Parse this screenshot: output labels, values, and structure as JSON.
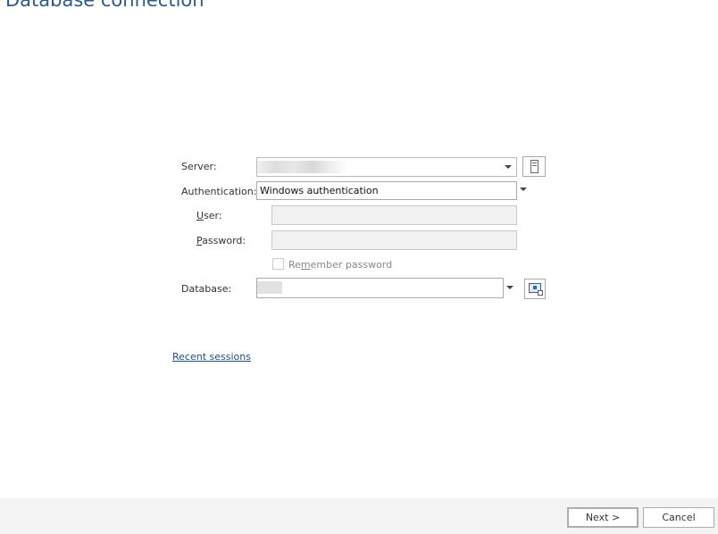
{
  "title": "Database connection",
  "form": {
    "server_label": "Server:",
    "server_value": "",
    "authentication_label": "Authentication:",
    "authentication_value": "Windows authentication",
    "user_label_u": "U",
    "user_label_post": "ser:",
    "password_label_u": "P",
    "password_label_post": "assword:",
    "remember_pre": "Re",
    "remember_u": "m",
    "remember_post": "ember password",
    "remember_checked": false,
    "database_label": "Database:",
    "database_value": ""
  },
  "recent_sessions": "Recent sessions",
  "footer": {
    "next": "Next >",
    "cancel": "Cancel"
  },
  "colors": {
    "title": "#2e5b8f",
    "link": "#1f4e8c",
    "footer_bg": "#f3f3f3"
  }
}
